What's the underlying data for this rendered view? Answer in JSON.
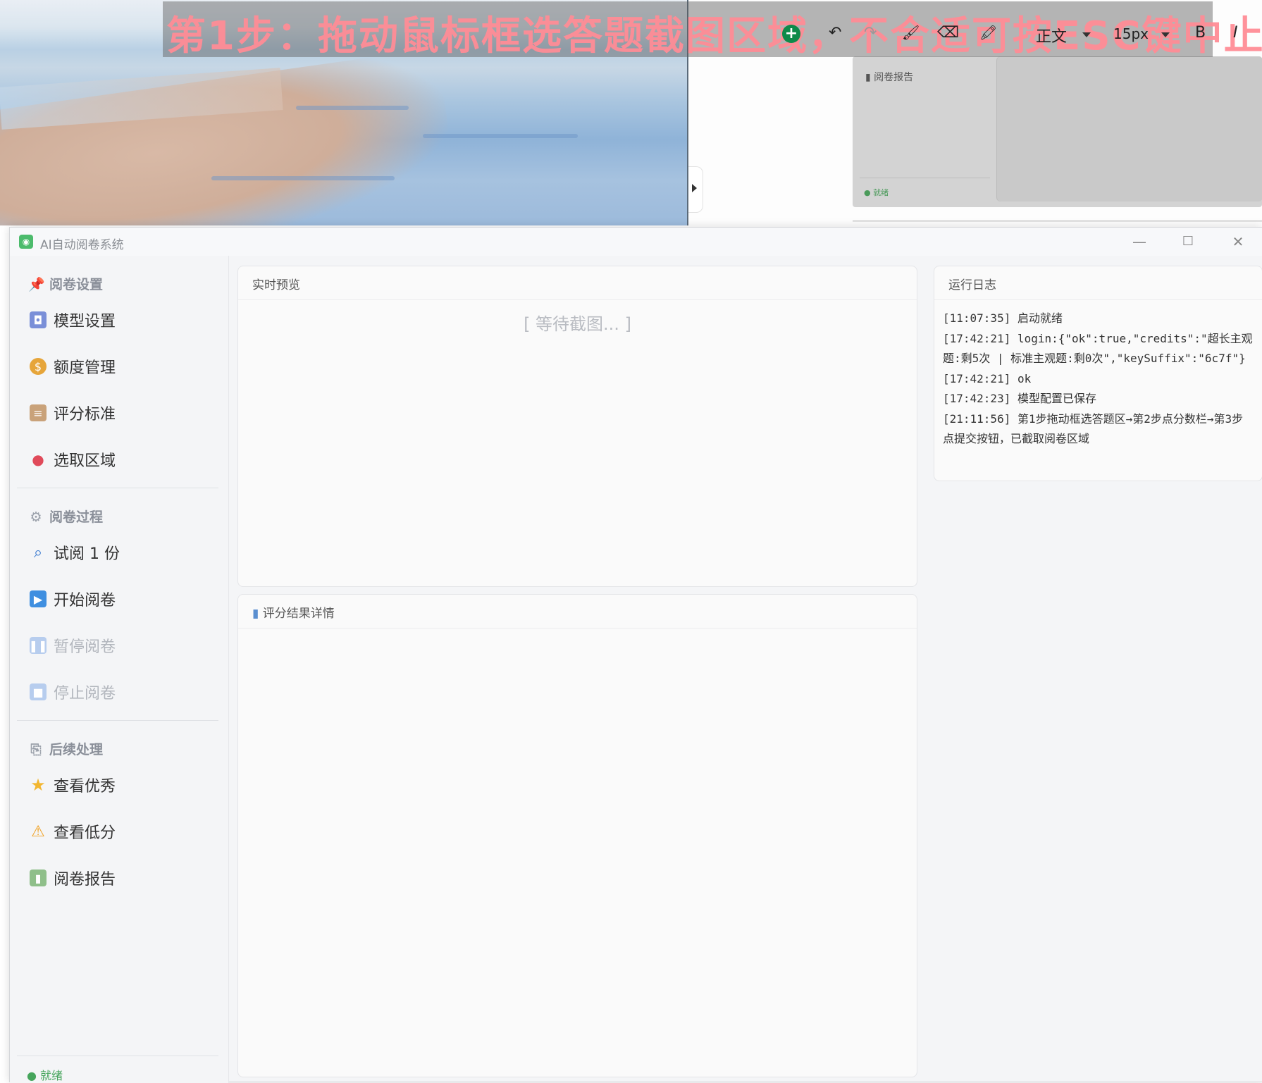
{
  "background": {
    "panel_label": "阅卷报告",
    "panel_status": "● 就绪"
  },
  "overlay": {
    "instruction": "第1步：拖动鼠标框选答题截图区域，不合适可按ESC键中止",
    "toolbar": {
      "add": "+",
      "undo": "↶",
      "redo": "↷",
      "format_painter": "🖌",
      "eraser": "⌫",
      "highlighter": "🖍",
      "text_style": "正文",
      "font_size": "15px",
      "bold": "B",
      "italic": "I"
    }
  },
  "window": {
    "title": "AI自动阅卷系统",
    "controls": {
      "minimize": "—",
      "maximize": "☐",
      "close": "✕"
    }
  },
  "sidebar": {
    "sections": [
      {
        "title": "阅卷设置",
        "items": [
          {
            "label": "模型设置"
          },
          {
            "label": "额度管理"
          },
          {
            "label": "评分标准"
          },
          {
            "label": "选取区域"
          }
        ]
      },
      {
        "title": "阅卷过程",
        "items": [
          {
            "label": "试阅 1 份"
          },
          {
            "label": "开始阅卷"
          },
          {
            "label": "暂停阅卷"
          },
          {
            "label": "停止阅卷"
          }
        ]
      },
      {
        "title": "后续处理",
        "items": [
          {
            "label": "查看优秀"
          },
          {
            "label": "查看低分"
          },
          {
            "label": "阅卷报告"
          }
        ]
      }
    ],
    "status": "● 就绪"
  },
  "preview": {
    "title": "实时预览",
    "placeholder": "[ 等待截图... ]"
  },
  "results": {
    "title": "评分结果详情"
  },
  "log": {
    "title": "运行日志",
    "lines": [
      "[11:07:35] 启动就绪",
      "[17:42:21] login:{\"ok\":true,\"credits\":\"超长主观题:剩5次 | 标准主观题:剩0次\",\"keySuffix\":\"6c7f\"}",
      "[17:42:21] ok",
      "[17:42:23] 模型配置已保存",
      "[21:11:56] 第1步拖动框选答题区→第2步点分数栏→第3步点提交按钮，已截取阅卷区域"
    ]
  },
  "colors": {
    "status_green": "#46a55c",
    "icon_green": "#0e8a4a",
    "overlay_text": "#ff8c96"
  }
}
